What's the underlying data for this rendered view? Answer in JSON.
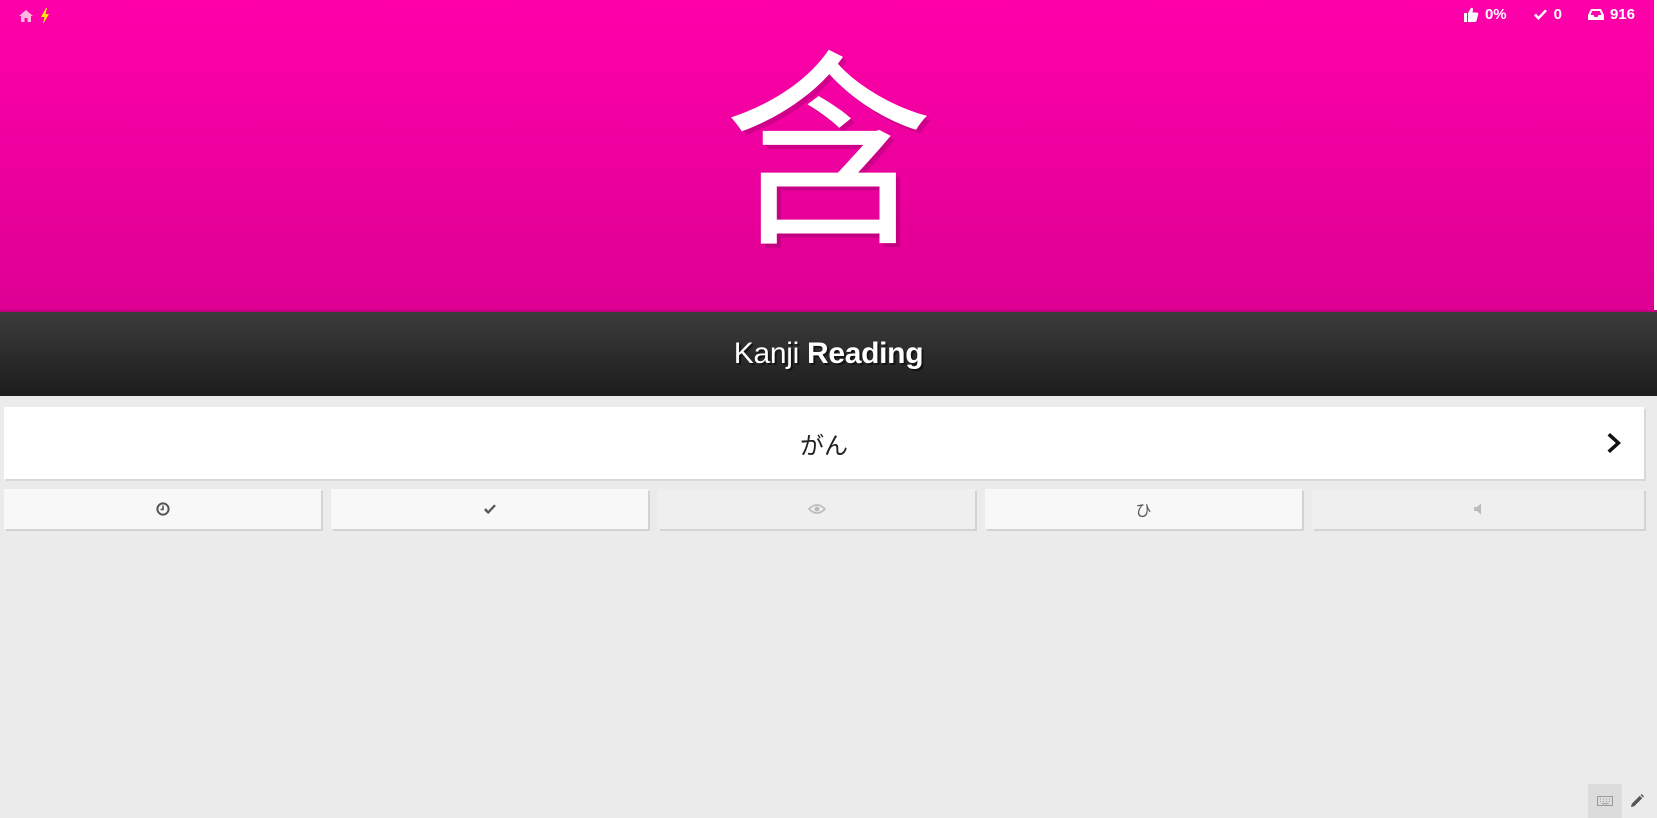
{
  "header": {
    "background_color": "#ff00aa",
    "nav": {
      "home_icon": "home-icon",
      "lightning_icon": "lightning-icon",
      "lightning_color": "#ffea00"
    },
    "stats": {
      "percent_correct": "0%",
      "completed_count": "0",
      "available_count": "916"
    }
  },
  "question": {
    "character": "含",
    "type_label": "Kanji",
    "type_strong": "Reading"
  },
  "answer": {
    "value": "がん",
    "placeholder": ""
  },
  "additional_content": [
    {
      "icon": "clock-icon",
      "enabled": true
    },
    {
      "icon": "checkmark-icon",
      "enabled": true
    },
    {
      "icon": "eye-icon",
      "enabled": false
    },
    {
      "label": "ひ",
      "icon": "hiragana-icon",
      "enabled": true
    },
    {
      "icon": "audio-icon",
      "enabled": false
    }
  ],
  "hotkeys": {
    "keyboard_icon": "keyboard-icon",
    "edit_icon": "pencil-icon"
  }
}
